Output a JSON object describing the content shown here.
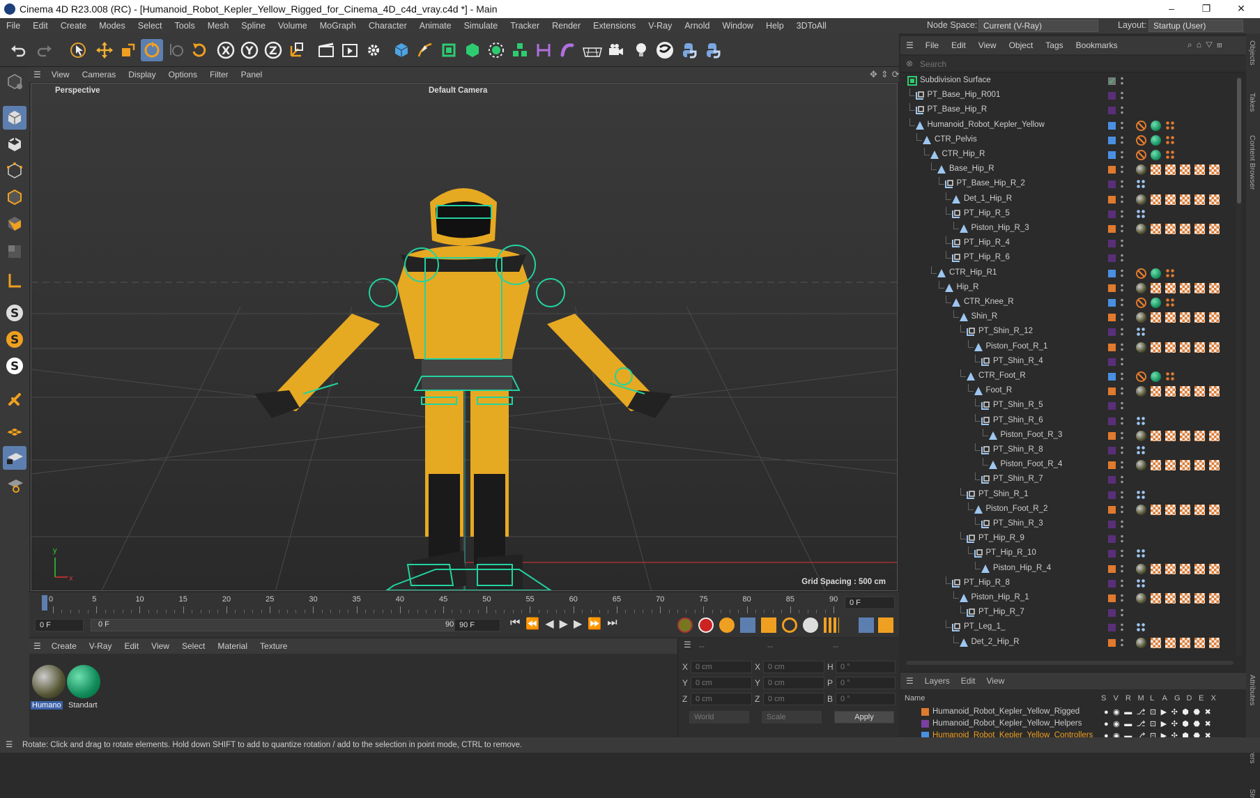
{
  "window": {
    "title": "Cinema 4D R23.008 (RC) - [Humanoid_Robot_Kepler_Yellow_Rigged_for_Cinema_4D_c4d_vray.c4d *] - Main",
    "minimize": "–",
    "maximize": "❐",
    "close": "✕"
  },
  "menubar": {
    "items": [
      "File",
      "Edit",
      "Create",
      "Modes",
      "Select",
      "Tools",
      "Mesh",
      "Spline",
      "Volume",
      "MoGraph",
      "Character",
      "Animate",
      "Simulate",
      "Tracker",
      "Render",
      "Extensions",
      "V-Ray",
      "Arnold",
      "Window",
      "Help",
      "3DToAll"
    ],
    "node_space_label": "Node Space:",
    "node_space_value": "Current (V-Ray)",
    "layout_label": "Layout:",
    "layout_value": "Startup (User)"
  },
  "viewport": {
    "menu": [
      "View",
      "Cameras",
      "Display",
      "Options",
      "Filter",
      "Panel"
    ],
    "view_name": "Perspective",
    "camera": "Default Camera",
    "grid_spacing": "Grid Spacing : 500 cm",
    "axis_x": "x",
    "axis_y": "y"
  },
  "timeline": {
    "ticks": [
      "0",
      "5",
      "10",
      "15",
      "20",
      "25",
      "30",
      "35",
      "40",
      "45",
      "50",
      "55",
      "60",
      "65",
      "70",
      "75",
      "80",
      "85",
      "90"
    ],
    "current_frame_field": "0 F",
    "start_field": "0 F",
    "range_start": "0 F",
    "range_end": "90 F",
    "end_field": "90 F"
  },
  "materials": {
    "menu": [
      "Create",
      "V-Ray",
      "Edit",
      "View",
      "Select",
      "Material",
      "Texture"
    ],
    "items": [
      {
        "name": "Humano",
        "selected": true
      },
      {
        "name": "Standart",
        "selected": false
      }
    ]
  },
  "coords": {
    "header_a": "--",
    "header_b": "--",
    "header_c": "--",
    "rows": [
      {
        "a_label": "X",
        "a_val": "0 cm",
        "b_label": "X",
        "b_val": "0 cm",
        "c_label": "H",
        "c_val": "0 °"
      },
      {
        "a_label": "Y",
        "a_val": "0 cm",
        "b_label": "Y",
        "b_val": "0 cm",
        "c_label": "P",
        "c_val": "0 °"
      },
      {
        "a_label": "Z",
        "a_val": "0 cm",
        "b_label": "Z",
        "b_val": "0 cm",
        "c_label": "B",
        "c_val": "0 °"
      }
    ],
    "world": "World",
    "scale": "Scale",
    "apply": "Apply"
  },
  "object_manager": {
    "menu": [
      "File",
      "Edit",
      "View",
      "Object",
      "Tags",
      "Bookmarks"
    ],
    "search_placeholder": "Search",
    "rows": [
      {
        "name": "Subdivision Surface",
        "level": 0,
        "type": "subd",
        "color": "#777777",
        "tags": "check"
      },
      {
        "name": "PT_Base_Hip_R001",
        "level": 1,
        "type": "null",
        "color": "#5a2f7a",
        "tags": ""
      },
      {
        "name": "PT_Base_Hip_R",
        "level": 1,
        "type": "null",
        "color": "#5a2f7a",
        "tags": ""
      },
      {
        "name": "Humanoid_Robot_Kepler_Yellow",
        "level": 1,
        "type": "joint",
        "color": "#4a90e2",
        "tags": "ctrl"
      },
      {
        "name": "CTR_Pelvis",
        "level": 2,
        "type": "joint",
        "color": "#4a90e2",
        "tags": "ctrl"
      },
      {
        "name": "CTR_Hip_R",
        "level": 3,
        "type": "joint",
        "color": "#4a90e2",
        "tags": "ctrl"
      },
      {
        "name": "Base_Hip_R",
        "level": 4,
        "type": "joint",
        "color": "#e07a2e",
        "tags": "mat"
      },
      {
        "name": "PT_Base_Hip_R_2",
        "level": 5,
        "type": "null",
        "color": "#5a2f7a",
        "tags": "pt"
      },
      {
        "name": "Det_1_Hip_R",
        "level": 6,
        "type": "joint",
        "color": "#e07a2e",
        "tags": "mat"
      },
      {
        "name": "PT_Hip_R_5",
        "level": 6,
        "type": "null",
        "color": "#5a2f7a",
        "tags": "pt"
      },
      {
        "name": "Piston_Hip_R_3",
        "level": 7,
        "type": "joint",
        "color": "#e07a2e",
        "tags": "mat"
      },
      {
        "name": "PT_Hip_R_4",
        "level": 6,
        "type": "null",
        "color": "#5a2f7a",
        "tags": ""
      },
      {
        "name": "PT_Hip_R_6",
        "level": 6,
        "type": "null",
        "color": "#5a2f7a",
        "tags": ""
      },
      {
        "name": "CTR_Hip_R1",
        "level": 4,
        "type": "joint",
        "color": "#4a90e2",
        "tags": "ctrl"
      },
      {
        "name": "Hip_R",
        "level": 5,
        "type": "joint",
        "color": "#e07a2e",
        "tags": "mat"
      },
      {
        "name": "CTR_Knee_R",
        "level": 6,
        "type": "joint",
        "color": "#4a90e2",
        "tags": "ctrl"
      },
      {
        "name": "Shin_R",
        "level": 7,
        "type": "joint",
        "color": "#e07a2e",
        "tags": "mat"
      },
      {
        "name": "PT_Shin_R_12",
        "level": 8,
        "type": "null",
        "color": "#5a2f7a",
        "tags": "pt"
      },
      {
        "name": "Piston_Foot_R_1",
        "level": 9,
        "type": "joint",
        "color": "#e07a2e",
        "tags": "mat"
      },
      {
        "name": "PT_Shin_R_4",
        "level": 10,
        "type": "null",
        "color": "#5a2f7a",
        "tags": ""
      },
      {
        "name": "CTR_Foot_R",
        "level": 8,
        "type": "joint",
        "color": "#4a90e2",
        "tags": "ctrl"
      },
      {
        "name": "Foot_R",
        "level": 9,
        "type": "joint",
        "color": "#e07a2e",
        "tags": "mat"
      },
      {
        "name": "PT_Shin_R_5",
        "level": 10,
        "type": "null",
        "color": "#5a2f7a",
        "tags": ""
      },
      {
        "name": "PT_Shin_R_6",
        "level": 10,
        "type": "null",
        "color": "#5a2f7a",
        "tags": "pt"
      },
      {
        "name": "Piston_Foot_R_3",
        "level": 11,
        "type": "joint",
        "color": "#e07a2e",
        "tags": "mat"
      },
      {
        "name": "PT_Shin_R_8",
        "level": 10,
        "type": "null",
        "color": "#5a2f7a",
        "tags": "pt"
      },
      {
        "name": "Piston_Foot_R_4",
        "level": 11,
        "type": "joint",
        "color": "#e07a2e",
        "tags": "mat"
      },
      {
        "name": "PT_Shin_R_7",
        "level": 10,
        "type": "null",
        "color": "#5a2f7a",
        "tags": ""
      },
      {
        "name": "PT_Shin_R_1",
        "level": 8,
        "type": "null",
        "color": "#5a2f7a",
        "tags": "pt"
      },
      {
        "name": "Piston_Foot_R_2",
        "level": 9,
        "type": "joint",
        "color": "#e07a2e",
        "tags": "mat"
      },
      {
        "name": "PT_Shin_R_3",
        "level": 10,
        "type": "null",
        "color": "#5a2f7a",
        "tags": ""
      },
      {
        "name": "PT_Hip_R_9",
        "level": 8,
        "type": "null",
        "color": "#5a2f7a",
        "tags": ""
      },
      {
        "name": "PT_Hip_R_10",
        "level": 9,
        "type": "null",
        "color": "#5a2f7a",
        "tags": "pt"
      },
      {
        "name": "Piston_Hip_R_4",
        "level": 10,
        "type": "joint",
        "color": "#e07a2e",
        "tags": "mat"
      },
      {
        "name": "PT_Hip_R_8",
        "level": 6,
        "type": "null",
        "color": "#5a2f7a",
        "tags": "pt"
      },
      {
        "name": "Piston_Hip_R_1",
        "level": 7,
        "type": "joint",
        "color": "#e07a2e",
        "tags": "mat"
      },
      {
        "name": "PT_Hip_R_7",
        "level": 8,
        "type": "null",
        "color": "#5a2f7a",
        "tags": ""
      },
      {
        "name": "PT_Leg_1_",
        "level": 6,
        "type": "null",
        "color": "#5a2f7a",
        "tags": "pt"
      },
      {
        "name": "Det_2_Hip_R",
        "level": 7,
        "type": "joint",
        "color": "#e07a2e",
        "tags": "mat"
      }
    ]
  },
  "layers_panel": {
    "menu": [
      "Layers",
      "Edit",
      "View"
    ],
    "name_header": "Name",
    "cols": [
      "S",
      "V",
      "R",
      "M",
      "L",
      "A",
      "G",
      "D",
      "E",
      "X"
    ],
    "items": [
      {
        "name": "Humanoid_Robot_Kepler_Yellow_Rigged",
        "color": "#e07a2e",
        "active": false
      },
      {
        "name": "Humanoid_Robot_Kepler_Yellow_Helpers",
        "color": "#7a3fa0",
        "active": false
      },
      {
        "name": "Humanoid_Robot_Kepler_Yellow_Controllers",
        "color": "#4a90e2",
        "active": true
      }
    ]
  },
  "right_tabs": [
    "Objects",
    "Takes",
    "Content Browser",
    "Attributes",
    "Layers",
    "Str"
  ],
  "status": "Rotate: Click and drag to rotate elements. Hold down SHIFT to add to quantize rotation / add to the selection in point mode, CTRL to remove."
}
